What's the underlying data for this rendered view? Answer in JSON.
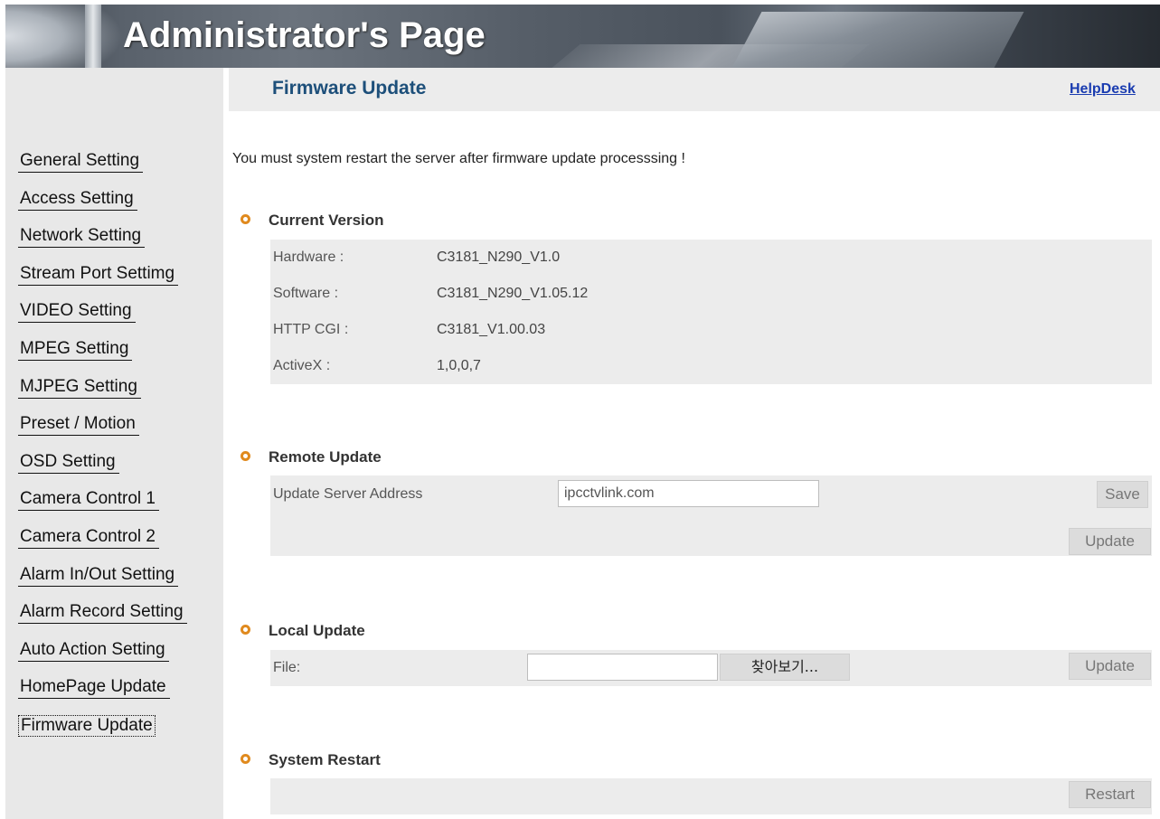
{
  "header": {
    "title": "Administrator's Page"
  },
  "sidebar": {
    "items": [
      {
        "label": "General Setting"
      },
      {
        "label": "Access Setting"
      },
      {
        "label": "Network Setting"
      },
      {
        "label": "Stream Port Settimg"
      },
      {
        "label": "VIDEO Setting"
      },
      {
        "label": "MPEG Setting"
      },
      {
        "label": "MJPEG Setting"
      },
      {
        "label": "Preset / Motion"
      },
      {
        "label": "OSD Setting"
      },
      {
        "label": "Camera Control 1"
      },
      {
        "label": "Camera Control 2"
      },
      {
        "label": "Alarm In/Out Setting"
      },
      {
        "label": "Alarm Record Setting"
      },
      {
        "label": "Auto Action Setting"
      },
      {
        "label": "HomePage Update"
      },
      {
        "label": "Firmware Update"
      }
    ],
    "active": "Firmware Update"
  },
  "main": {
    "title": "Firmware Update",
    "helpdesk": "HelpDesk",
    "notice": "You must system restart the server after firmware update processsing !",
    "current_version": {
      "heading": "Current Version",
      "rows": [
        {
          "label": "Hardware :",
          "value": "C3181_N290_V1.0"
        },
        {
          "label": "Software :",
          "value": "C3181_N290_V1.05.12"
        },
        {
          "label": "HTTP CGI :",
          "value": "C3181_V1.00.03"
        },
        {
          "label": "ActiveX :",
          "value": "1,0,0,7"
        }
      ]
    },
    "remote_update": {
      "heading": "Remote Update",
      "label": "Update Server Address",
      "value": "ipcctvlink.com",
      "save_label": "Save",
      "update_label": "Update"
    },
    "local_update": {
      "heading": "Local Update",
      "label": "File:",
      "value": "",
      "browse_label": "찾아보기...",
      "update_label": "Update"
    },
    "system_restart": {
      "heading": "System Restart",
      "restart_label": "Restart"
    }
  },
  "colors": {
    "accent_bullet": "#e08a1e",
    "title_blue": "#1d4f7a",
    "link_blue": "#1a3cb0",
    "panel_gray": "#ececec"
  }
}
